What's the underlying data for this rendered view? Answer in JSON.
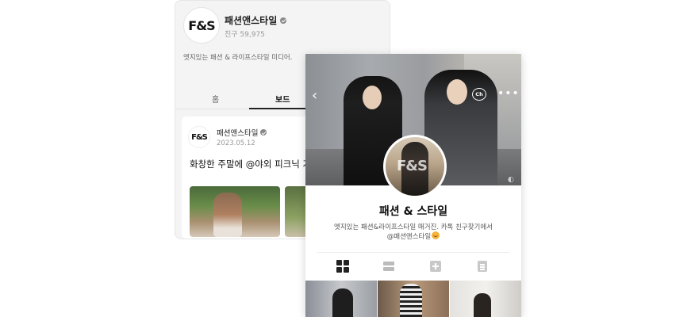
{
  "channel": {
    "logo": "F&S",
    "name": "패션앤스타일",
    "friends": "친구 59,975",
    "description": "엣지있는 패션 & 라이프스타일 미디어.",
    "tabs": {
      "home": "홈",
      "board": "보드"
    }
  },
  "post": {
    "author": "패션앤스타일",
    "date": "2023.05.12",
    "title": "화창한 주말에 @야외 피크닉 가"
  },
  "profile": {
    "chat_icon_label": "Ch",
    "name": "패션 & 스타일",
    "desc_line1": "엣지있는 패션&라이프스타일 매거진. 카톡 친구찾기에서",
    "desc_line2": "@패션앤스타일"
  },
  "icons": {
    "back": "chevron-left-icon",
    "chat": "kakao-channel-icon",
    "more": "more-icon",
    "verified": "verified-badge-icon",
    "grid": "grid-view-icon",
    "list": "list-view-icon",
    "add": "add-post-icon",
    "document": "document-icon",
    "emoji": "smiling-face-with-hearts-emoji"
  },
  "colors": {
    "accent": "#222222",
    "verified": "#888888"
  }
}
